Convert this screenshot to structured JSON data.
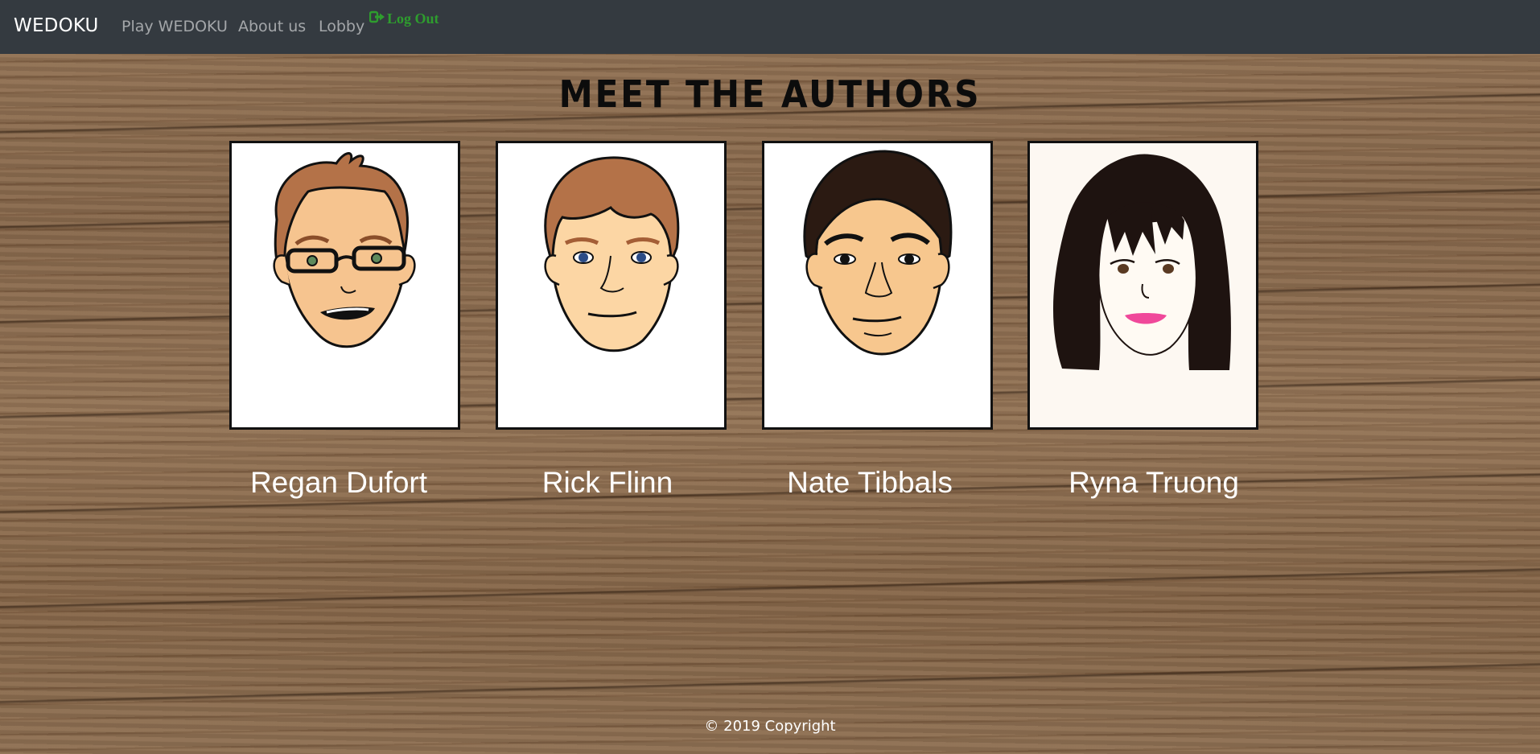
{
  "nav": {
    "brand": "WEDOKU",
    "links": [
      "Play WEDOKU",
      "About us",
      "Lobby"
    ],
    "logout_label": "Log Out",
    "logout_icon": "sign-out-icon",
    "logout_color": "#2e9d2e",
    "background": "#343a40"
  },
  "main": {
    "title": "Meet the Authors",
    "authors": [
      {
        "name": "Regan Dufort",
        "portrait": "cartoon-man-glasses"
      },
      {
        "name": "Rick Flinn",
        "portrait": "cartoon-man-blue-eyes"
      },
      {
        "name": "Nate Tibbals",
        "portrait": "cartoon-man-dark-hair"
      },
      {
        "name": "Ryna Truong",
        "portrait": "cartoon-woman-long-hair"
      }
    ]
  },
  "footer": {
    "copyright": "© 2019 Copyright"
  }
}
